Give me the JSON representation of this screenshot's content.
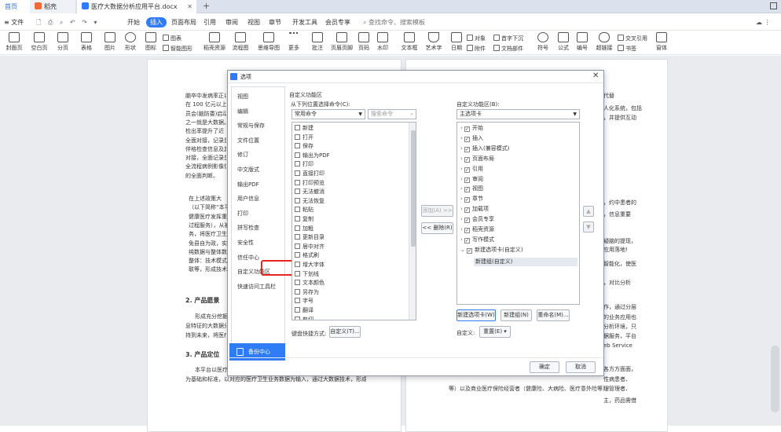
{
  "tabs": {
    "home": "首页",
    "t2": "稻壳",
    "doc": "医疗大数据分析应用平台.docx"
  },
  "menu": {
    "file": "文件",
    "items": [
      "开始",
      "插入",
      "页面布局",
      "引用",
      "审阅",
      "视图",
      "章节",
      "开发工具",
      "会员专享"
    ],
    "search": "查找命令、搜索模板"
  },
  "ribbon": {
    "items": [
      "封面页",
      "空白页",
      "分页",
      "表格",
      "图片",
      "形状",
      "图标",
      "稻壳资源",
      "流程图",
      "思维导图",
      "更多",
      "批注",
      "页眉页脚",
      "页码",
      "水印",
      "文本框",
      "艺术字",
      "日期",
      "附件",
      "对象",
      "首字下沉",
      "文档部件",
      "符号",
      "公式",
      "编号",
      "超链接",
      "交叉引用",
      "书签",
      "窗体"
    ],
    "extra": [
      "图表",
      "智能图形"
    ]
  },
  "doc_left": {
    "lines": [
      "脑卒中发病率正以",
      "在 100 亿元以上。",
      "员会(脑防委)启动",
      "之一就是大数据。",
      "检出率提升了近 10",
      "全面对接，记录患",
      "伴格检查信息及其",
      "对接，全面记录患",
      "全流程病例影像信",
      "的全面判断。",
      "在上述政策大",
      "（以下简称“本平",
      "健康医疗发挥重要",
      "过程服务），从被",
      "务，将医疗卫生工",
      "免县自为政，实行",
      "纯数据与整体数据",
      "整体：技术模式（",
      "联等，形成技术合"
    ],
    "h2": "2. 产品愿景",
    "p2": [
      "形成充分挖掘",
      "息特征的大数据分",
      "持到未来，将医疗"
    ],
    "h3": "3. 产品定位",
    "p3": [
      "本平台以医疗",
      "为基础和标准，以对应的医疗卫生业务数据为输入，通过大数据技术，形成针对"
    ]
  },
  "doc_right": {
    "lines": [
      "代替",
      "人化系统，包括",
      "，并提供互动",
      "，约中患者的",
      "，信息重要",
      "疑脑的提现，",
      "应用落地!",
      "智能化，使医",
      "，对比分析",
      "作，通过分层",
      "的业务应用也",
      "分析环境，只",
      "据服务，平台",
      "eb Service",
      "各方方面面，",
      "性病患者、",
      "理管理者、",
      "主，药品需借"
    ],
    "p_end": "等）以及商业医疗保险经营者（健康险、大病险、医疗意外险等）。"
  },
  "dialog": {
    "title": "选项",
    "nav": [
      "视图",
      "编辑",
      "常规与保存",
      "文件位置",
      "修订",
      "中文版式",
      "输出PDF",
      "用户信息",
      "打印",
      "拼写检查",
      "安全性",
      "信任中心",
      "自定义功能区",
      "快速访问工具栏"
    ],
    "backup": "备份中心",
    "section": "自定义功能区",
    "from_label": "从下列位置选择命令(C):",
    "from_value": "常用命令",
    "search_placeholder": "搜索命令",
    "commands": [
      "新建",
      "打开",
      "保存",
      "输出为PDF",
      "打印",
      "直接打印",
      "打印预览",
      "无法撤消",
      "无法恢复",
      "粘贴",
      "复制",
      "加粗",
      "更新目录",
      "居中对齐",
      "格式刷",
      "增大字体",
      "下划线",
      "文本颜色",
      "另存为",
      "字号",
      "翻译",
      "剪切"
    ],
    "add": "添加(A) >>",
    "remove": "<< 删除(R)",
    "to_label": "自定义功能区(B):",
    "to_value": "主选项卡",
    "tree": [
      "开始",
      "插入",
      "插入(兼容模式)",
      "页面布局",
      "引用",
      "审阅",
      "视图",
      "章节",
      "加载项",
      "会员专享",
      "稻壳资源",
      "写作模式",
      "新建选项卡(自定义)"
    ],
    "new_group": "新建组(自定义)",
    "new_tab": "新建选项卡(W)",
    "new_grp_btn": "新建组(N)",
    "rename": "重命名(M)...",
    "custom_label": "自定义:",
    "reset": "重置(E)",
    "shortcut_label": "键盘快捷方式:",
    "shortcut_btn": "自定义(T)...",
    "ok": "确定",
    "cancel": "取消"
  }
}
